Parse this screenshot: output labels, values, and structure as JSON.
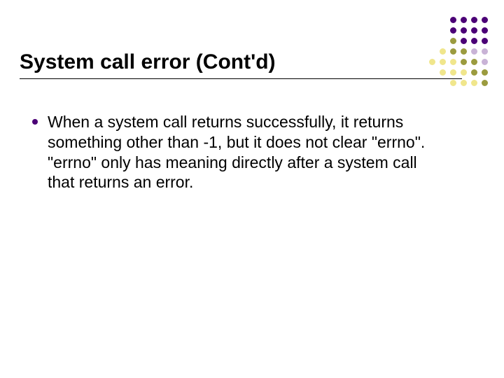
{
  "slide": {
    "title": "System call error (Cont'd)",
    "bullets": [
      "When a system call returns successfully, it returns something other than -1, but it does not clear \"errno\".  \"errno\" only has meaning directly after a system call that returns an error."
    ]
  }
}
